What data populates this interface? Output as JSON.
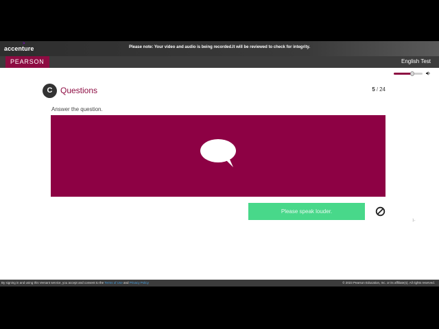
{
  "header": {
    "brand": "accenture",
    "brand_mark": ">",
    "notice": "Please note: Your video and audio is being recorded.It will be reviewed to check for integrity."
  },
  "nav": {
    "logo": "PEARSON",
    "test_name": "English Test"
  },
  "volume": {
    "level": 0.65,
    "icon": "speaker-icon"
  },
  "question": {
    "badge": "C",
    "title": "Questions",
    "current": "5",
    "separator": "/",
    "total": "24",
    "instruction": "Answer the question."
  },
  "media": {
    "icon": "speech-bubble-icon",
    "color": "#8d0144"
  },
  "status": {
    "message": "Please speak louder.",
    "color": "#48d88a",
    "stop_icon": "no-entry-icon"
  },
  "page_mark": "1-",
  "footer": {
    "left_prefix": "By signing in and using this Versant service, you accept and consent to the",
    "terms_link": "Terms of Use",
    "and_text": "and",
    "privacy_link": "Privacy Policy",
    "copyright": "© 2023 Pearson Education, Inc. or its affiliate(s). All rights reserved."
  },
  "colors": {
    "brand_accent": "#8d0c42",
    "brand_purple": "#a100ff"
  }
}
